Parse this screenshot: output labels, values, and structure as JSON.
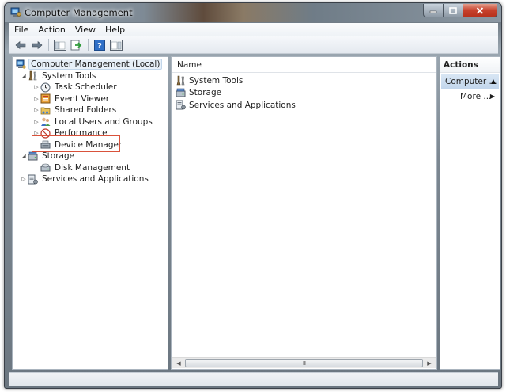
{
  "window": {
    "title": "Computer Management"
  },
  "menubar": {
    "items": [
      "File",
      "Action",
      "View",
      "Help"
    ]
  },
  "toolbar": {
    "icons": [
      "back-arrow-icon",
      "forward-arrow-icon",
      "show-hide-console-tree-icon",
      "export-list-icon",
      "help-icon",
      "show-hide-action-pane-icon"
    ]
  },
  "tree": {
    "root": "Computer Management (Local)",
    "system_tools": "System Tools",
    "task_scheduler": "Task Scheduler",
    "event_viewer": "Event Viewer",
    "shared_folders": "Shared Folders",
    "local_users": "Local Users and Groups",
    "performance": "Performance",
    "device_manager": "Device Manager",
    "storage": "Storage",
    "disk_management": "Disk Management",
    "services_apps": "Services and Applications"
  },
  "list": {
    "column_name": "Name",
    "rows": [
      "System Tools",
      "Storage",
      "Services and Applications"
    ],
    "scroll_grip": "III"
  },
  "actions": {
    "header": "Actions",
    "group": "Computer ...",
    "more": "More ..."
  },
  "colors": {
    "highlight_box": "#d9523b",
    "selection": "#c2d6ec"
  }
}
